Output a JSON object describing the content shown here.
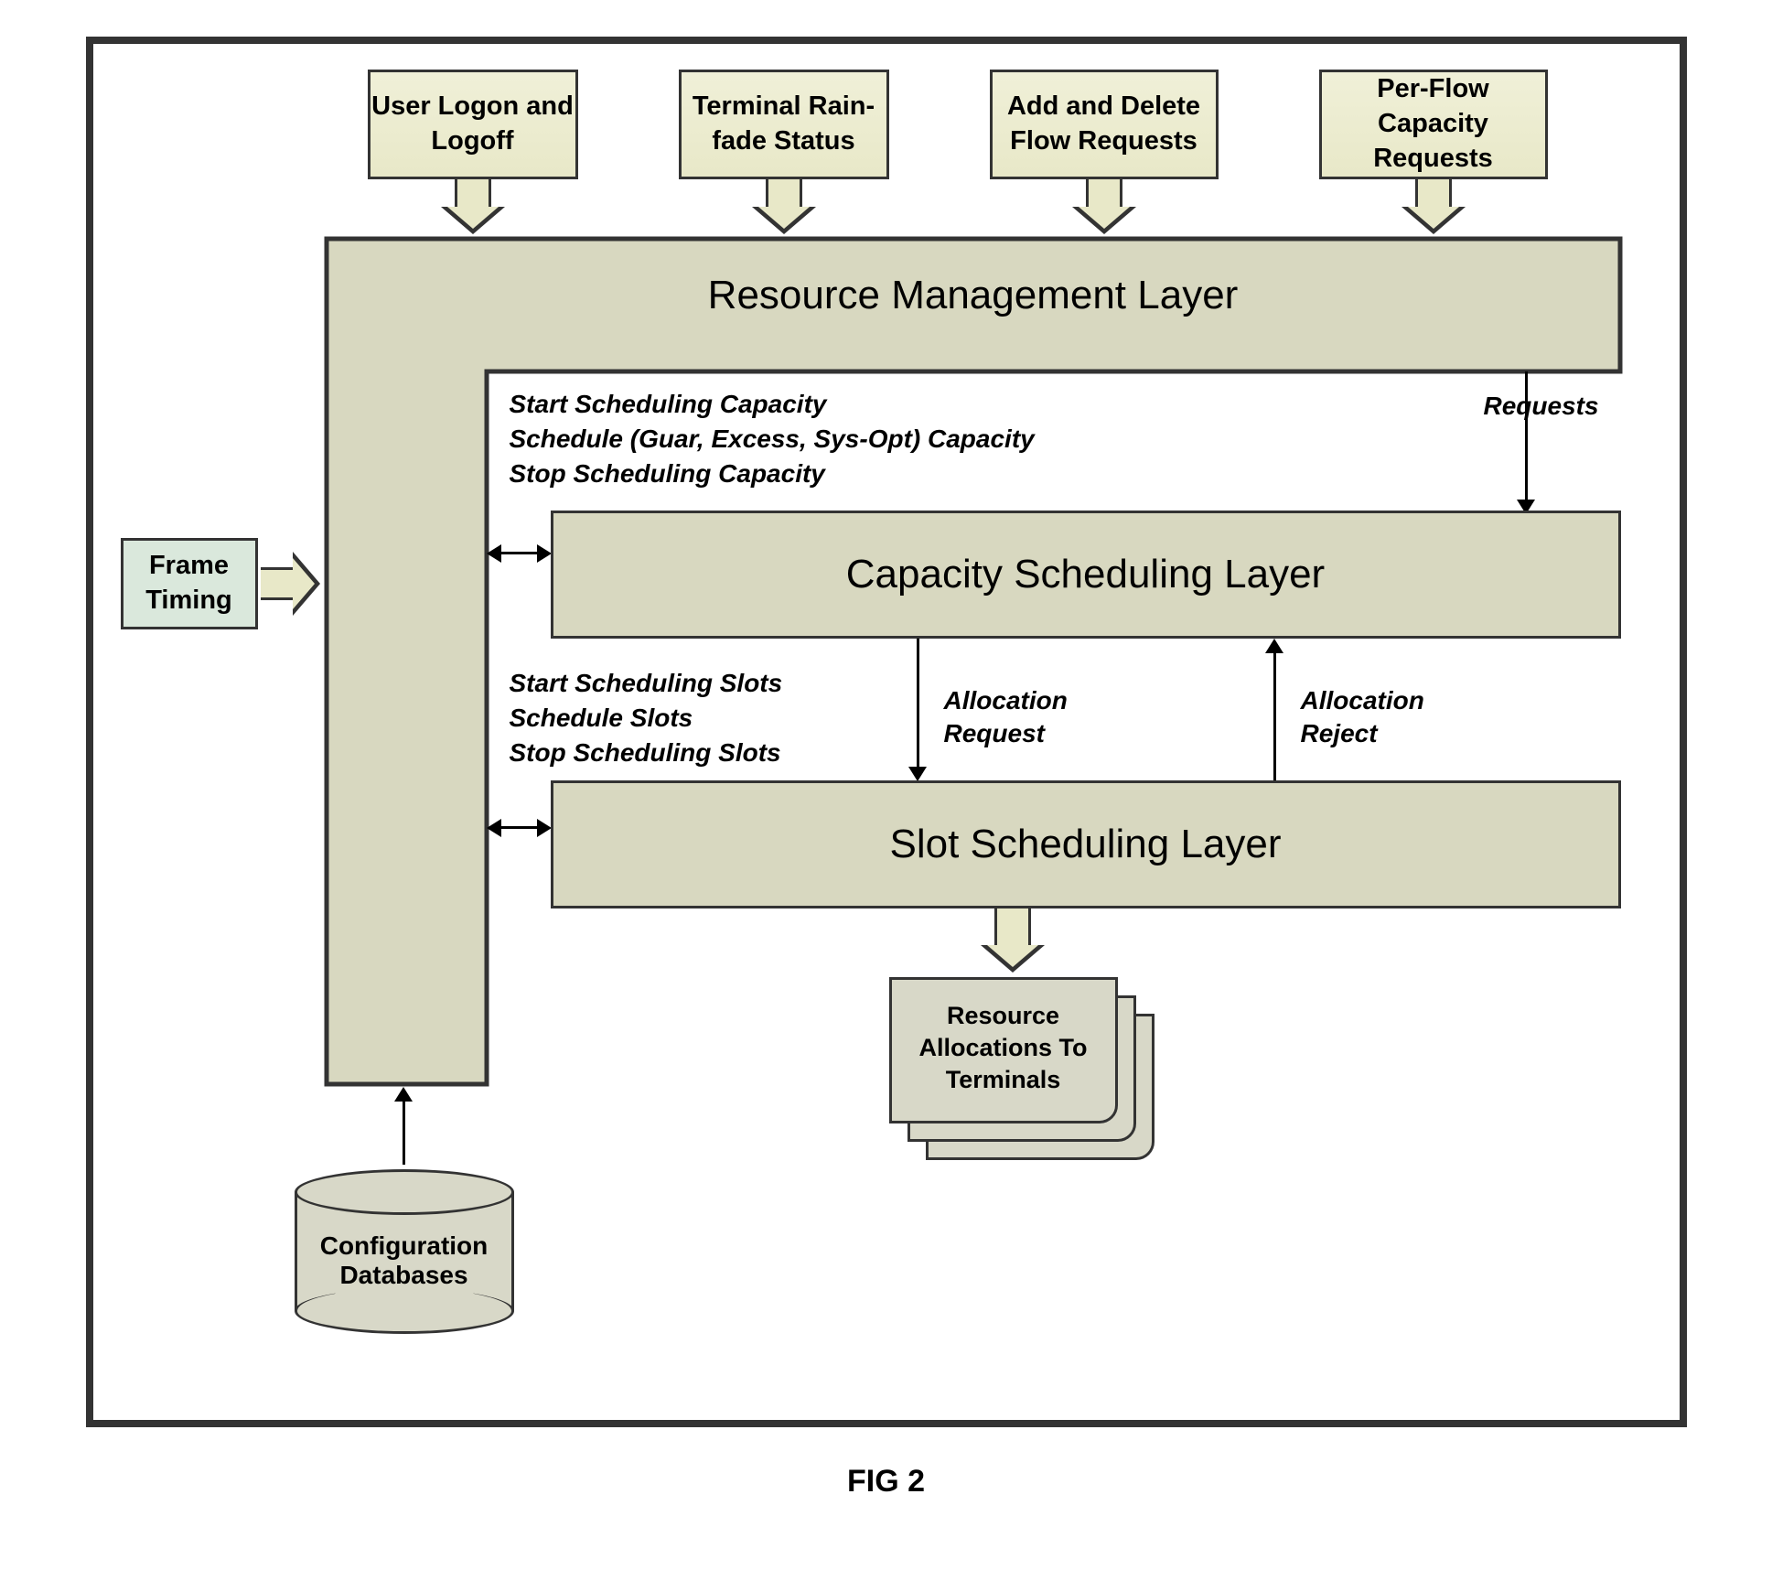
{
  "inputs": {
    "user_logon": "User Logon and Logoff",
    "terminal_status": "Terminal Rain-fade Status",
    "add_delete": "Add and Delete Flow Requests",
    "per_flow": "Per-Flow Capacity Requests"
  },
  "frame_timing": "Frame Timing",
  "layers": {
    "rml": "Resource Management Layer",
    "csl": "Capacity Scheduling Layer",
    "ssl": "Slot Scheduling Layer"
  },
  "labels": {
    "requests": "Requests",
    "capacity_ops": "Start Scheduling Capacity\nSchedule (Guar, Excess, Sys-Opt) Capacity\nStop Scheduling Capacity",
    "slot_ops": "Start Scheduling Slots\nSchedule Slots\nStop Scheduling Slots",
    "alloc_request": "Allocation Request",
    "alloc_reject": "Allocation Reject"
  },
  "database": "Configuration Databases",
  "output_docs": "Resource Allocations To Terminals",
  "figure": "FIG 2"
}
